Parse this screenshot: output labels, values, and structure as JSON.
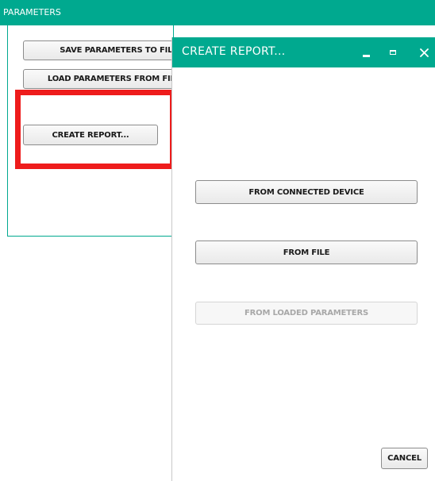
{
  "parameters_panel": {
    "title": "PARAMETERS",
    "buttons": {
      "save": "SAVE PARAMETERS TO FILE...",
      "load": "LOAD PARAMETERS FROM FILE...",
      "create_report": "CREATE REPORT..."
    }
  },
  "dialog": {
    "title": "CREATE REPORT...",
    "controls": {
      "minimize_icon": "minimize-icon",
      "maximize_icon": "maximize-icon",
      "close_icon": "close-icon"
    },
    "options": {
      "from_connected_device": "FROM CONNECTED DEVICE",
      "from_file": "FROM FILE",
      "from_loaded_parameters": "FROM LOADED PARAMETERS"
    },
    "cancel": "CANCEL"
  },
  "colors": {
    "accent": "#00a98f",
    "highlight": "#ee1c1c",
    "disabled_text": "#a8a8a8"
  }
}
